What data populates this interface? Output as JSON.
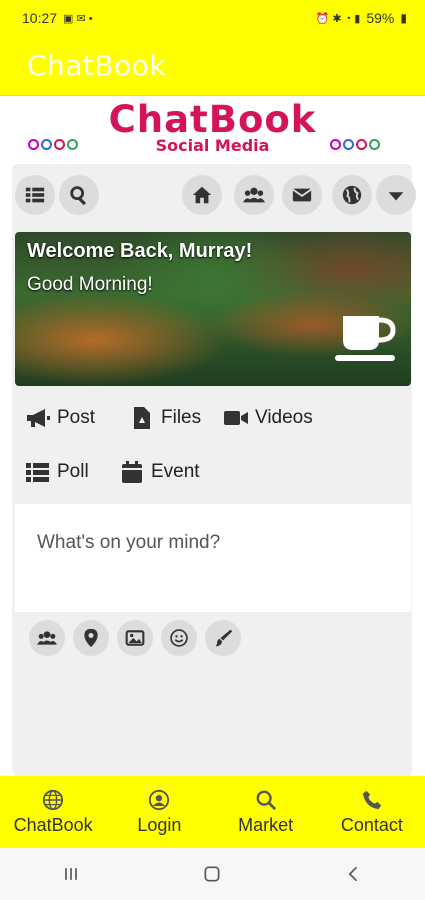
{
  "status_bar": {
    "time": "10:27",
    "battery": "59%"
  },
  "app_bar": {
    "title": "ChatBook"
  },
  "logo": {
    "main": "ChatBook",
    "sub": "Social Media"
  },
  "toolbar": {
    "left": [
      "list-icon",
      "search-icon"
    ],
    "right": [
      "home-icon",
      "users-icon",
      "envelope-icon",
      "globe-icon",
      "caret-down-icon"
    ]
  },
  "hero": {
    "title": "Welcome Back, Murray!",
    "subtitle": "Good Morning!"
  },
  "post_options": {
    "post": "Post",
    "files": "Files",
    "videos": "Videos",
    "poll": "Poll",
    "event": "Event"
  },
  "composer": {
    "placeholder": "What's on your mind?"
  },
  "attach_icons": [
    "users-icon",
    "map-marker-icon",
    "image-icon",
    "smile-icon",
    "brush-icon"
  ],
  "bottom_nav": {
    "items": [
      {
        "label": "ChatBook",
        "icon": "globe-icon"
      },
      {
        "label": "Login",
        "icon": "user-icon"
      },
      {
        "label": "Market",
        "icon": "search-icon"
      },
      {
        "label": "Contact",
        "icon": "phone-icon"
      }
    ]
  },
  "colors": {
    "accent": "#ffff00",
    "brand": "#d4145a"
  }
}
